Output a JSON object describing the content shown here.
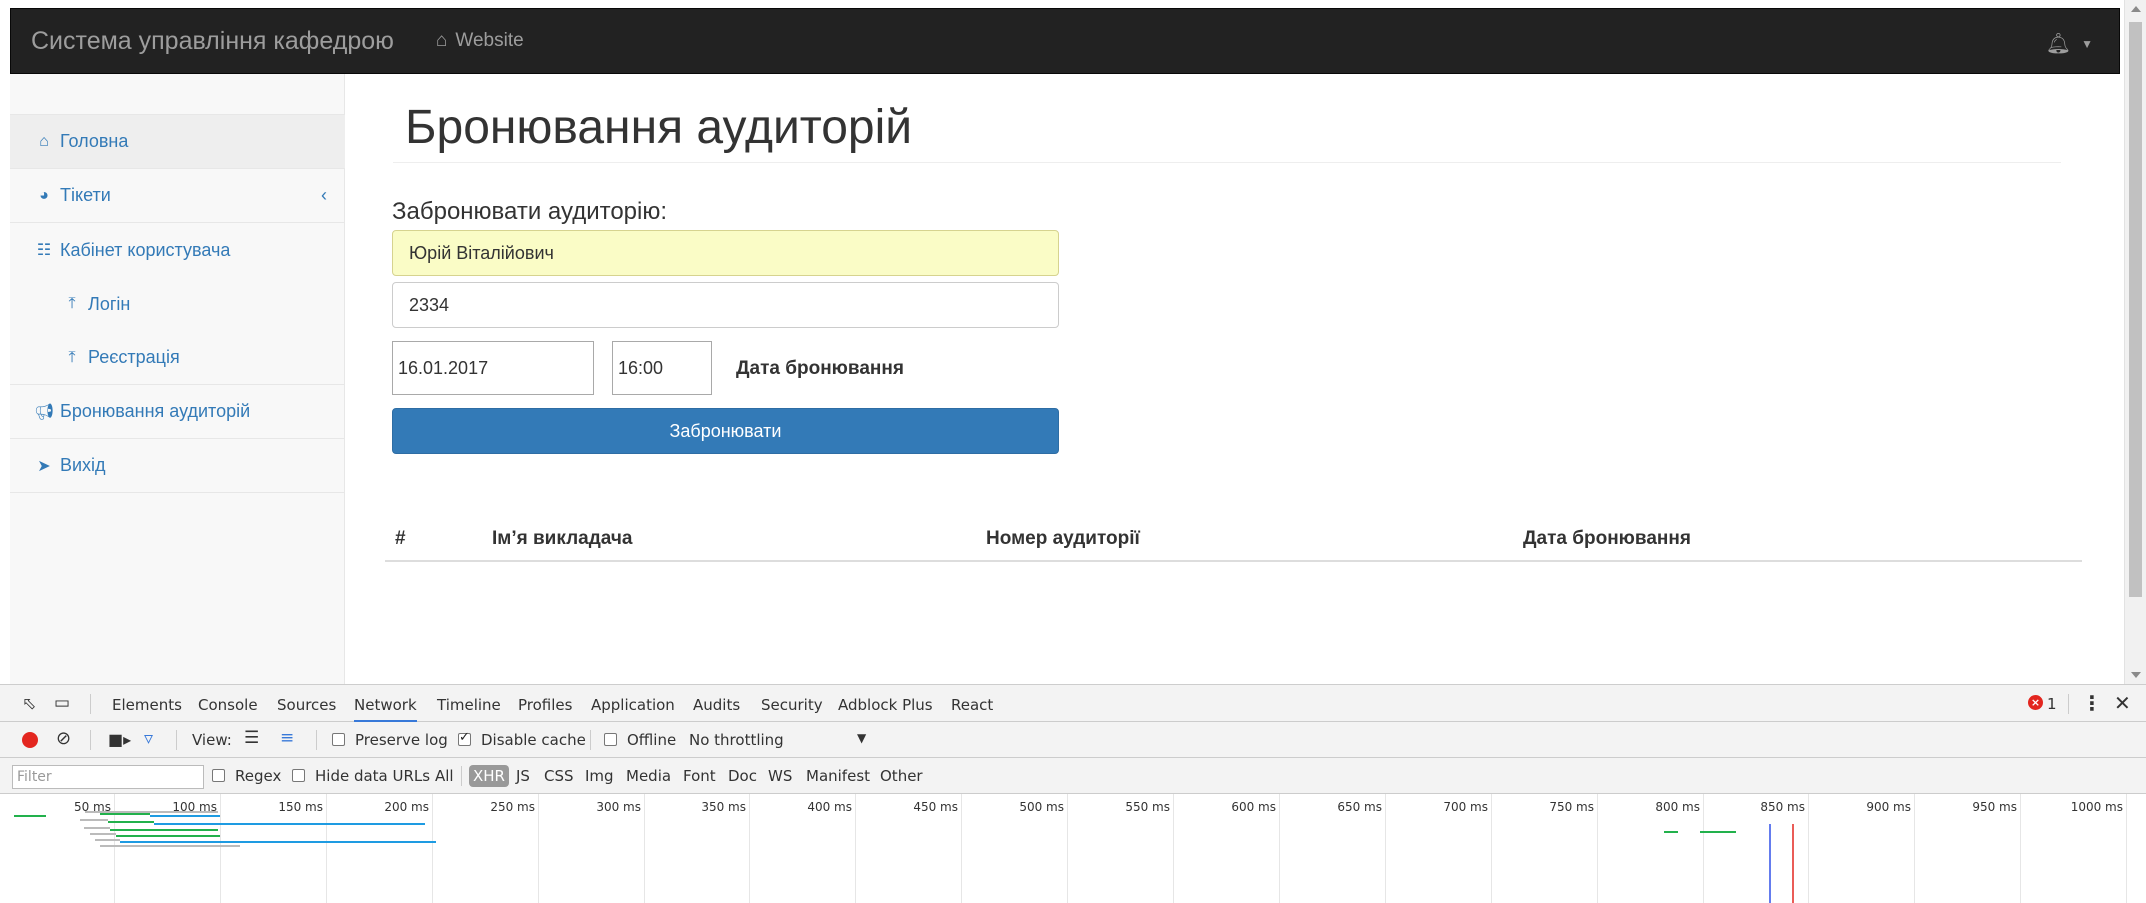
{
  "navbar": {
    "brand": "Система управління кафедрою",
    "website": "Website"
  },
  "sidebar": {
    "items": [
      {
        "label": "Головна",
        "icon": "home-icon"
      },
      {
        "label": "Тікети",
        "icon": "dashboard-icon"
      },
      {
        "label": "Кабінет користувача",
        "icon": "sitemap-icon"
      },
      {
        "label": "Логін",
        "icon": "upload-icon"
      },
      {
        "label": "Реєстрація",
        "icon": "upload-icon"
      },
      {
        "label": "Бронювання аудиторій",
        "icon": "bullhorn-icon"
      },
      {
        "label": "Вихід",
        "icon": "paper-plane-icon"
      }
    ]
  },
  "main": {
    "title": "Бронювання аудиторій",
    "form_label": "Забронювати аудиторію:",
    "teacher_value": "Юрій Віталійович",
    "room_value": "2334",
    "date_value": "16.01.2017",
    "time_value": "16:00",
    "date_caption": "Дата бронювання",
    "book_button": "Забронювати",
    "table_headers": [
      "#",
      "Імʼя викладача",
      "Номер аудиторії",
      "Дата бронювання"
    ]
  },
  "devtools": {
    "tabs": [
      "Elements",
      "Console",
      "Sources",
      "Network",
      "Timeline",
      "Profiles",
      "Application",
      "Audits",
      "Security",
      "Adblock Plus",
      "React"
    ],
    "active_tab": "Network",
    "error_count": "1",
    "toolbar": {
      "view_label": "View:",
      "preserve_log": "Preserve log",
      "disable_cache": "Disable cache",
      "offline": "Offline",
      "throttling": "No throttling"
    },
    "filterbar": {
      "filter_placeholder": "Filter",
      "regex": "Regex",
      "hide_data_urls": "Hide data URLs",
      "types": [
        "All",
        "XHR",
        "JS",
        "CSS",
        "Img",
        "Media",
        "Font",
        "Doc",
        "WS",
        "Manifest",
        "Other"
      ]
    },
    "timeline_ticks": [
      "50 ms",
      "100 ms",
      "150 ms",
      "200 ms",
      "250 ms",
      "300 ms",
      "350 ms",
      "400 ms",
      "450 ms",
      "500 ms",
      "550 ms",
      "600 ms",
      "650 ms",
      "700 ms",
      "750 ms",
      "800 ms",
      "850 ms",
      "900 ms",
      "950 ms",
      "1000 ms"
    ]
  },
  "colors": {
    "primary": "#337ab7",
    "navbar": "#222222",
    "autofill": "#fafcc6",
    "record": "#e3261f"
  }
}
